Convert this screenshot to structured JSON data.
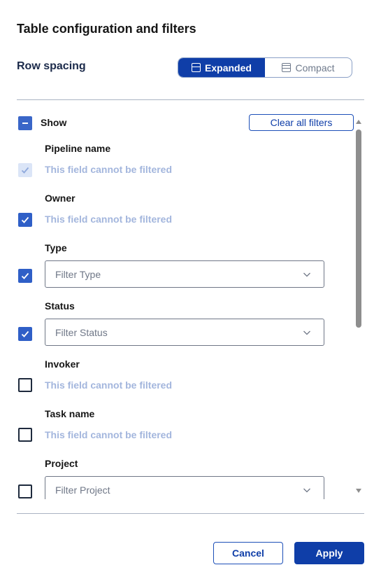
{
  "dialog": {
    "title": "Table configuration and filters"
  },
  "row_spacing": {
    "label": "Row spacing",
    "options": [
      {
        "label": "Expanded",
        "icon": "rows-expanded-icon",
        "selected": true
      },
      {
        "label": "Compact",
        "icon": "rows-compact-icon",
        "selected": false
      }
    ]
  },
  "list_header": {
    "show_label": "Show",
    "show_state": "indeterminate",
    "clear_filters_label": "Clear all filters"
  },
  "fields": [
    {
      "name": "Pipeline name",
      "checked": true,
      "disabled": true,
      "filterable": false,
      "message": "This field cannot be filtered"
    },
    {
      "name": "Owner",
      "checked": true,
      "disabled": false,
      "filterable": false,
      "message": "This field cannot be filtered"
    },
    {
      "name": "Type",
      "checked": true,
      "disabled": false,
      "filterable": true,
      "placeholder": "Filter Type"
    },
    {
      "name": "Status",
      "checked": true,
      "disabled": false,
      "filterable": true,
      "placeholder": "Filter Status"
    },
    {
      "name": "Invoker",
      "checked": false,
      "disabled": false,
      "filterable": false,
      "message": "This field cannot be filtered"
    },
    {
      "name": "Task name",
      "checked": false,
      "disabled": false,
      "filterable": false,
      "message": "This field cannot be filtered"
    },
    {
      "name": "Project",
      "checked": false,
      "disabled": false,
      "filterable": true,
      "placeholder": "Filter Project"
    }
  ],
  "footer": {
    "cancel_label": "Cancel",
    "apply_label": "Apply"
  },
  "colors": {
    "primary": "#0f3ea8",
    "checkbox_checked": "#2f5fc7",
    "muted_text": "#a3b6dd"
  }
}
